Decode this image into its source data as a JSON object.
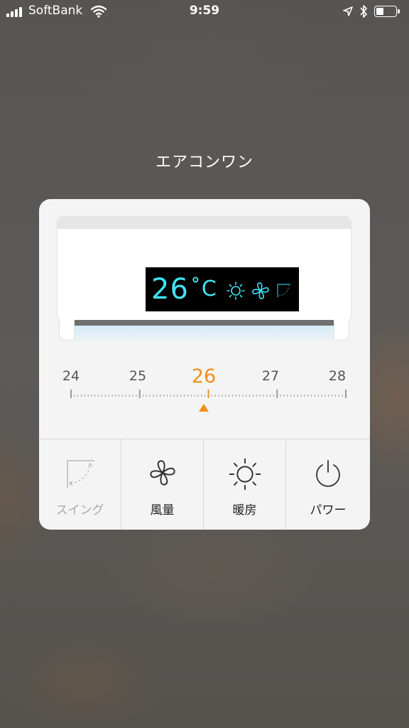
{
  "status_bar": {
    "carrier": "SoftBank",
    "time": "9:59"
  },
  "title": "エアコンワン",
  "display": {
    "temperature": "26",
    "unit": "˚C",
    "mode_icon": "sun-icon",
    "fan_icon": "fan-icon",
    "swing_icon": "swing-icon",
    "color": "#3fe3f0"
  },
  "slider": {
    "min": 24,
    "max": 28,
    "value": 26,
    "labels": [
      "24",
      "25",
      "26",
      "27",
      "28"
    ],
    "active_label": "26",
    "accent_color": "#f0901c"
  },
  "buttons": [
    {
      "label": "スイング",
      "icon": "swing-icon",
      "enabled": false
    },
    {
      "label": "風量",
      "icon": "fan-icon",
      "enabled": true
    },
    {
      "label": "暖房",
      "icon": "sun-icon",
      "enabled": true
    },
    {
      "label": "パワー",
      "icon": "power-icon",
      "enabled": true
    }
  ]
}
